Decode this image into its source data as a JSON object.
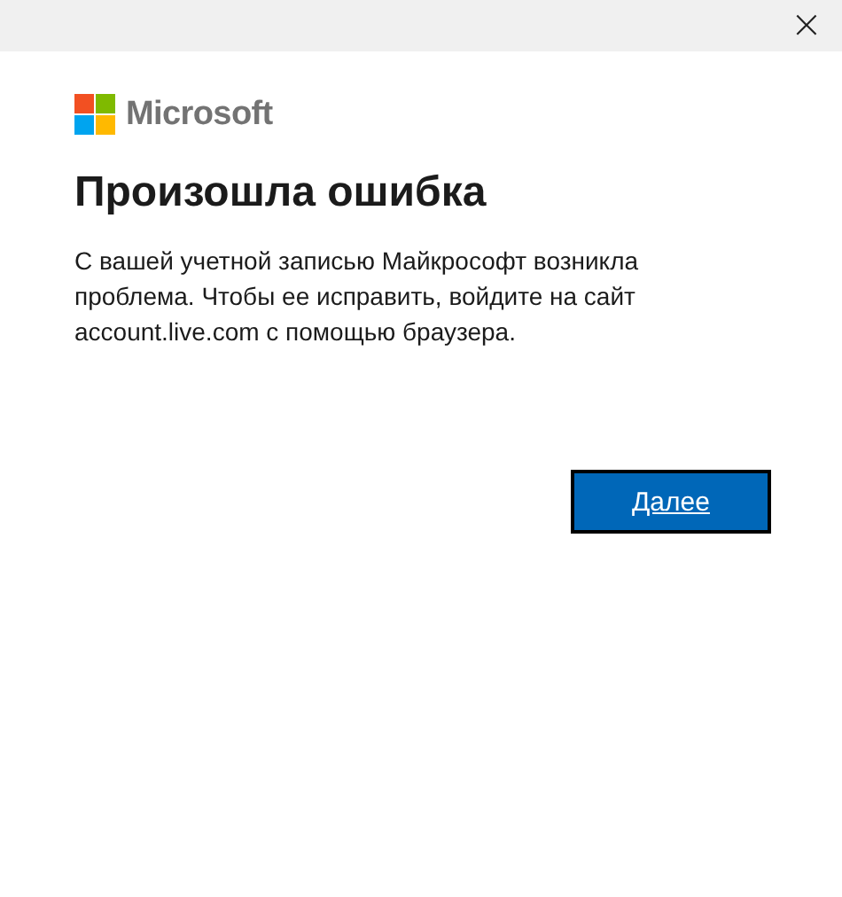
{
  "title_bar": {
    "close": "×"
  },
  "logo": {
    "text": "Microsoft"
  },
  "heading": "Произошла ошибка",
  "message": "С вашей учетной записью Майкрософт возникла проблема. Чтобы ее исправить, войдите на сайт account.live.com с помощью браузера.",
  "buttons": [
    {
      "label": "Далее",
      "kind": "primary"
    }
  ]
}
